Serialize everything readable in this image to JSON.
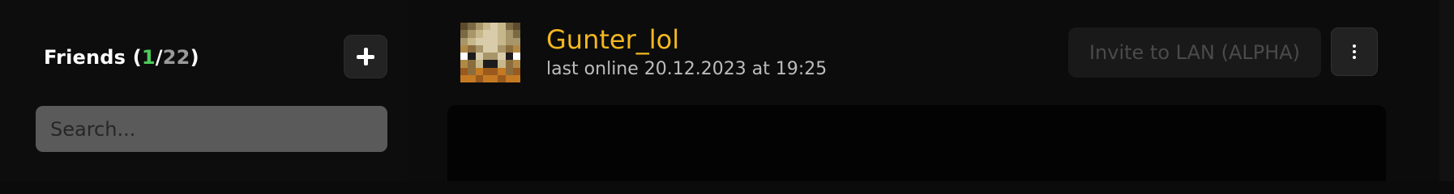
{
  "sidebar": {
    "friends_label": "Friends",
    "online_count": "1",
    "total_count": "22",
    "add_icon": "plus-icon",
    "search": {
      "placeholder": "Search...",
      "value": ""
    }
  },
  "friend": {
    "username": "Gunter_lol",
    "last_online": "last online 20.12.2023 at 19:25",
    "avatar_icon": "minecraft-skin-head"
  },
  "actions": {
    "invite_label": "Invite to LAN (ALPHA)",
    "more_icon": "kebab-menu-icon"
  },
  "colors": {
    "accent_username": "#f3b81f",
    "online_count": "#4ccb5a",
    "total_count": "#9a9a9a"
  }
}
